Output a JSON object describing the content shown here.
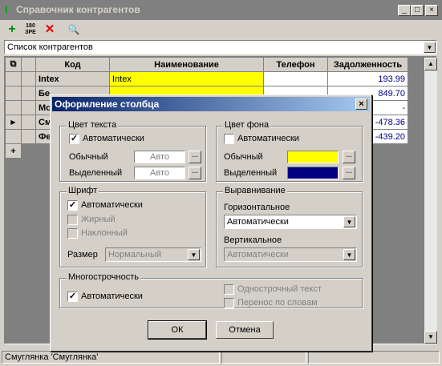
{
  "window": {
    "title": "Справочник контрагентов",
    "minimize": "_",
    "maximize": "□",
    "close": "×"
  },
  "toolbar": {
    "add": "+",
    "delete": "✕",
    "btn180_top": "180",
    "btn180_bottom": "ЗРЕ",
    "search": "🔍"
  },
  "list_combo": {
    "value": "Список контрагентов"
  },
  "grid": {
    "headers": {
      "code": "Код",
      "name": "Наименование",
      "phone": "Телефон",
      "debt": "Задолженность"
    },
    "rows": [
      {
        "code": "Intex",
        "name": "Intex",
        "phone": "",
        "debt": "193.99"
      },
      {
        "code": "Бе",
        "name": "",
        "phone": "",
        "debt": "849.70"
      },
      {
        "code": "Mo",
        "name": "",
        "phone": "",
        "debt": "-"
      },
      {
        "code": "См",
        "name": "",
        "phone": "",
        "debt": "-478.36"
      },
      {
        "code": "Фе",
        "name": "",
        "phone": "",
        "debt": "-439.20"
      }
    ],
    "current_row_marker": "▶",
    "add_row_marker": "+"
  },
  "status": {
    "left": "Смуглянка 'Смуглянка'"
  },
  "dialog": {
    "title": "Оформление столбца",
    "text_color": {
      "label": "Цвет текста",
      "auto_label": "Автоматически",
      "auto_checked": true,
      "normal_label": "Обычный",
      "normal_value": "Авто",
      "selected_label": "Выделенный",
      "selected_value": "Авто"
    },
    "bg_color": {
      "label": "Цвет фона",
      "auto_label": "Автоматически",
      "auto_checked": false,
      "normal_label": "Обычный",
      "normal_color": "#ffff00",
      "selected_label": "Выделенный",
      "selected_color": "#000080"
    },
    "font": {
      "label": "Шрифт",
      "auto_label": "Автоматически",
      "auto_checked": true,
      "bold_label": "Жирный",
      "italic_label": "Наклонный",
      "size_label": "Размер",
      "size_value": "Нормальный"
    },
    "alignment": {
      "label": "Выравнивание",
      "horizontal_label": "Горизонтальное",
      "horizontal_value": "Автоматически",
      "vertical_label": "Вертикальное",
      "vertical_value": "Автоматически"
    },
    "multiline": {
      "label": "Многострочность",
      "auto_label": "Автоматически",
      "auto_checked": true,
      "single_line_label": "Однострочный текст",
      "word_wrap_label": "Перенос по словам"
    },
    "ok_label": "ОК",
    "cancel_label": "Отмена",
    "dots": "..."
  }
}
